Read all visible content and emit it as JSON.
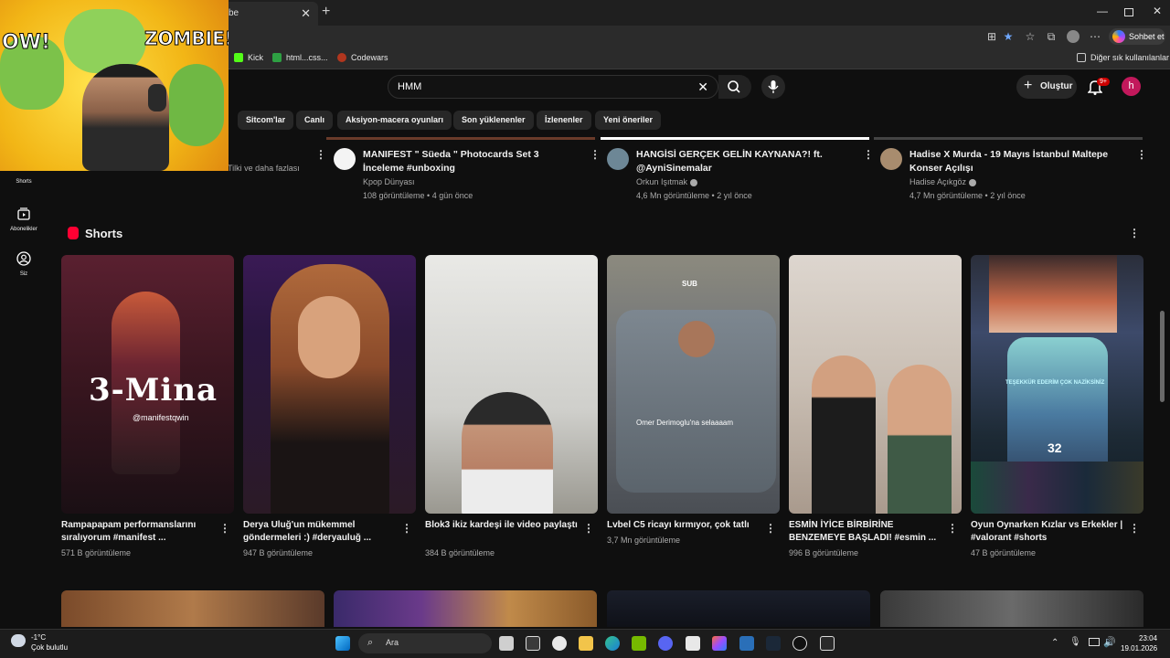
{
  "browser": {
    "tab_title": "be",
    "chat_button": "Sohbet et",
    "favorites": [
      "Kick",
      "html...css...",
      "Codewars"
    ],
    "other_favorites": "Diğer sık kullanılanlar"
  },
  "youtube": {
    "search_value": "HMM",
    "create_label": "Oluştur",
    "notif_count": "9+",
    "avatar_letter": "h",
    "chips": [
      "Sitcom'lar",
      "Canlı",
      "Aksiyon-macera oyunları",
      "Son yüklenenler",
      "İzlenenler",
      "Yeni öneriler"
    ],
    "sidebar": {
      "shorts": "Shorts",
      "subscriptions": "Abonelikler",
      "you": "Siz"
    },
    "partial_channel_line": "Tilki ve daha fazlası",
    "videos": [
      {
        "title": "MANIFEST \" Süeda \" Photocards Set 3 İnceleme #unboxing",
        "channel": "Kpop Dünyası",
        "meta": "108 görüntüleme • 4 gün önce",
        "verified": false
      },
      {
        "title": "HANGİSİ GERÇEK GELİN KAYNANA?! ft. @AyniSinemalar",
        "channel": "Orkun Işıtmak",
        "meta": "4,6 Mn görüntüleme • 2 yıl önce",
        "verified": true
      },
      {
        "title": "Hadise X Murda - 19 Mayıs İstanbul Maltepe Konser Açılışı",
        "channel": "Hadise Açıkgöz",
        "meta": "4,7 Mn görüntüleme • 2 yıl önce",
        "verified": true
      }
    ],
    "shorts_heading": "Shorts",
    "shorts": [
      {
        "title": "Rampapapam performanslarını sıralıyorum #manifest ...",
        "views": "571 B görüntüleme",
        "overlay": "3-Mina",
        "sub_overlay": "@manifestqwin"
      },
      {
        "title": "Derya Uluğ'un mükemmel göndermeleri :) #deryauluğ ...",
        "views": "947 B görüntüleme",
        "overlay": "",
        "sub_overlay": ""
      },
      {
        "title": "Blok3 ikiz kardeşi ile video paylaştı",
        "views": "384 B görüntüleme",
        "overlay": "",
        "sub_overlay": ""
      },
      {
        "title": "Lvbel C5 ricayı kırmıyor, çok tatlı",
        "views": "3,7 Mn görüntüleme",
        "overlay": "Omer Derimoglu'na selaaaam",
        "sub_overlay": "SUB"
      },
      {
        "title": "ESMİN İYİCE BİRBİRİNE BENZEMEYE BAŞLADI! #esmin ...",
        "views": "996 B görüntüleme",
        "overlay": "",
        "sub_overlay": ""
      },
      {
        "title": "Oyun Oynarken Kızlar vs Erkekler | #valorant #shorts",
        "views": "47 B görüntüleme",
        "overlay": "TEŞEKKÜR EDERİM ÇOK NAZİKSİNİZ",
        "sub_overlay": "32"
      }
    ]
  },
  "webcam": {
    "comic_left": "OW!",
    "comic_right": "ZOMBIE!"
  },
  "taskbar": {
    "temperature": "-1°C",
    "weather": "Çok bulutlu",
    "search": "Ara",
    "time": "23:04",
    "date": "19.01.2026"
  }
}
